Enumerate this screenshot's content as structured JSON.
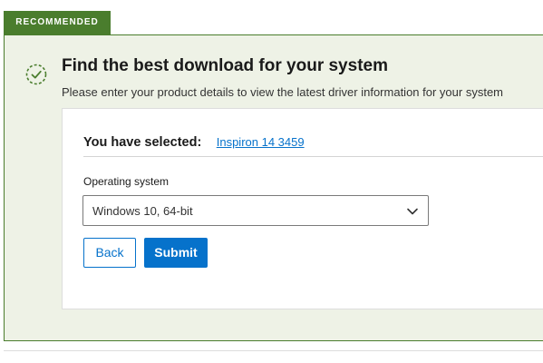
{
  "badge": {
    "label": "RECOMMENDED"
  },
  "header": {
    "title": "Find the best download for your system",
    "subtitle": "Please enter your product details to view the latest driver information for your system",
    "icon": "check-circle-icon"
  },
  "selection": {
    "label": "You have selected:",
    "product": "Inspiron 14 3459"
  },
  "os": {
    "label": "Operating system",
    "selected": "Windows 10, 64-bit"
  },
  "buttons": {
    "back": "Back",
    "submit": "Submit"
  },
  "colors": {
    "accent_green": "#4a7d2d",
    "panel_bg": "#eef2e6",
    "primary_blue": "#0672cb"
  }
}
